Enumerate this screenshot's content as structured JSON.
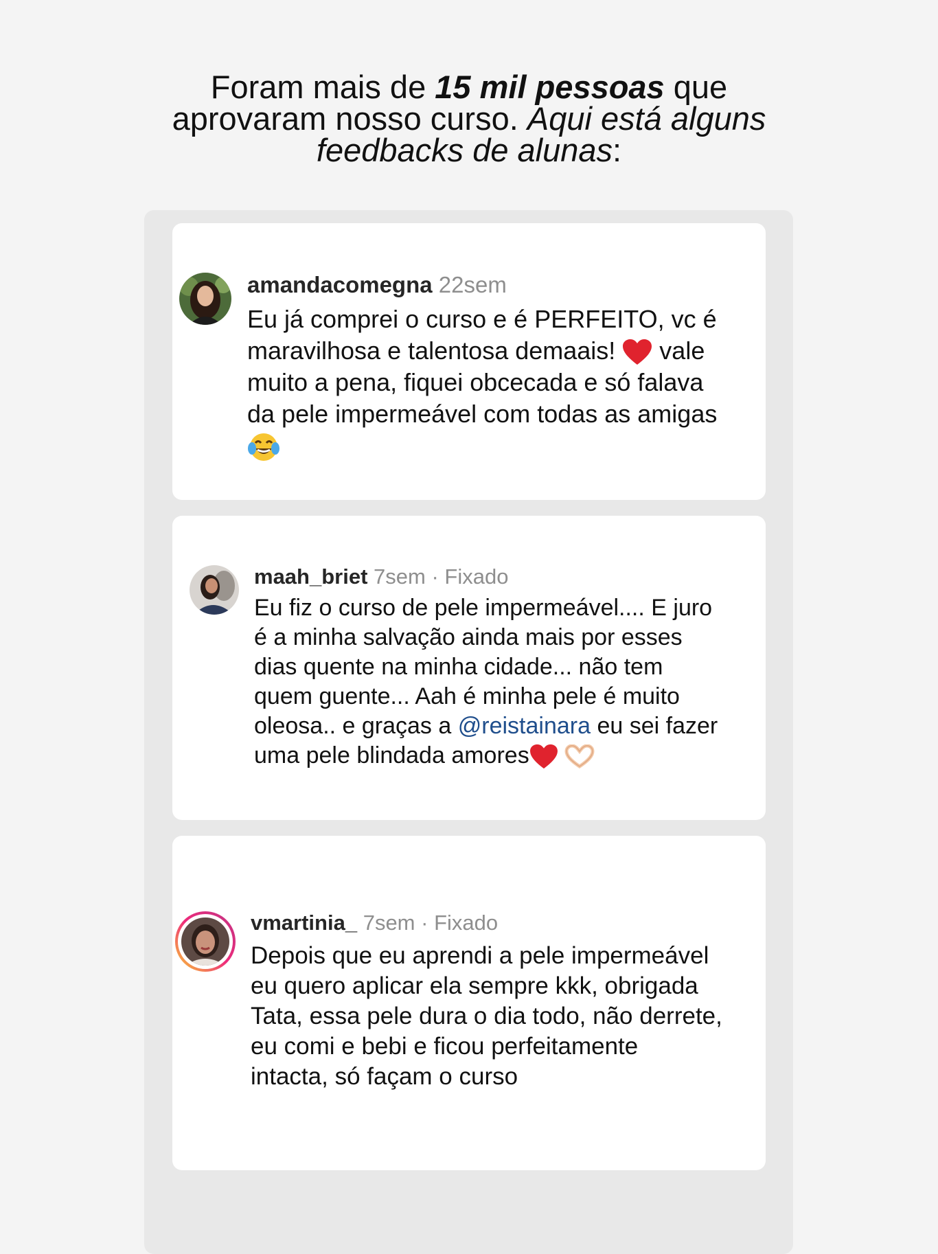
{
  "headline": {
    "line1_pre": "Foram mais de ",
    "line1_strong": "15 mil pessoas",
    "line1_post": " que",
    "line2_pre": "aprovaram nosso curso. ",
    "line2_em": "Aqui está alguns",
    "line3_em": "feedbacks de alunas",
    "line3_post": ":"
  },
  "comments": [
    {
      "username": "amandacomegna",
      "time": "22sem",
      "pinned_label": "",
      "lines": [
        "Eu já comprei o curso e é PERFEITO, vc é",
        "maravilhosa e talentosa demaais! ",
        " vale",
        "muito a pena, fiquei obcecada e só falava",
        "da pele impermeável com todas as amigas"
      ],
      "emojis": [
        "red-heart",
        "tears-of-joy"
      ]
    },
    {
      "username": "maah_briet",
      "time": "7sem",
      "separator": " · ",
      "pinned_label": "Fixado",
      "lines": [
        "Eu fiz o curso de pele impermeável.... E juro",
        "é a minha salvação ainda mais por esses",
        "dias quente na minha cidade... não tem",
        "quem guente... Aah é minha pele é muito",
        "oleosa.. e graças a ",
        " eu sei fazer",
        "uma pele blindada amores"
      ],
      "mention": "@reistainara",
      "emojis": [
        "red-heart",
        "heart-hands"
      ]
    },
    {
      "username": "vmartinia_",
      "time": "7sem",
      "separator": " · ",
      "pinned_label": "Fixado",
      "lines": [
        "Depois que eu aprendi a pele impermeável",
        "eu quero aplicar ela sempre kkk, obrigada",
        "Tata, essa pele dura o dia todo, não derrete,",
        "eu comi e bebi e ficou perfeitamente",
        "intacta, só façam o curso"
      ]
    }
  ],
  "colors": {
    "page_background": "#f4f4f4",
    "panel_background": "#e8e8e8",
    "card_background": "#ffffff",
    "username": "#262626",
    "muted": "#8e8e8e",
    "mention": "#1f4e8c",
    "story_ring_start": "#f9ce34",
    "story_ring_end": "#c13584"
  }
}
